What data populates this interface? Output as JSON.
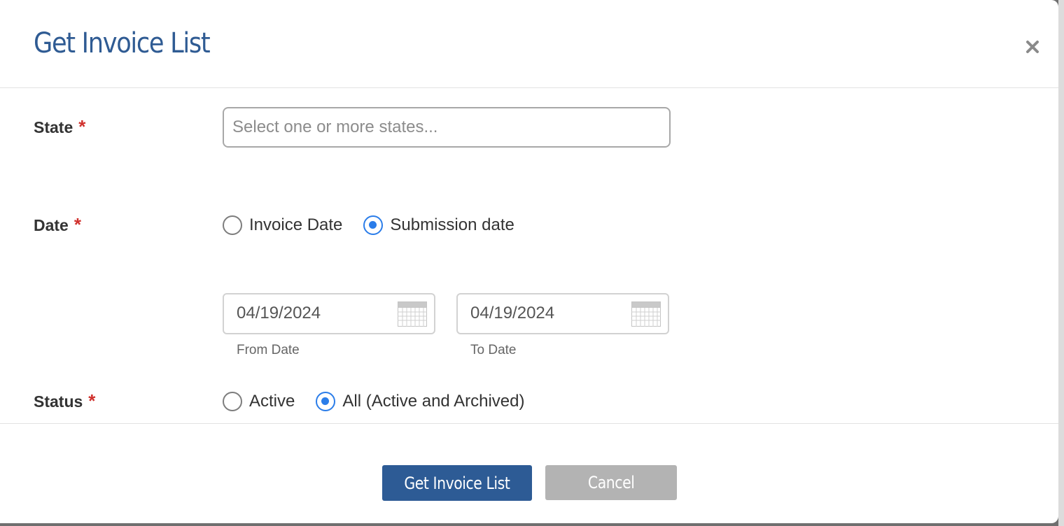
{
  "modal": {
    "title": "Get Invoice List",
    "close_icon": "close-icon"
  },
  "form": {
    "state": {
      "label": "State",
      "required_mark": "*",
      "placeholder": "Select one or more states...",
      "value": ""
    },
    "date": {
      "label": "Date",
      "required_mark": "*",
      "options": [
        {
          "label": "Invoice Date",
          "checked": false
        },
        {
          "label": "Submission date",
          "checked": true
        }
      ],
      "from": {
        "value": "04/19/2024",
        "caption": "From Date",
        "icon": "calendar-icon"
      },
      "to": {
        "value": "04/19/2024",
        "caption": "To Date",
        "icon": "calendar-icon"
      }
    },
    "status": {
      "label": "Status",
      "required_mark": "*",
      "options": [
        {
          "label": "Active",
          "checked": false
        },
        {
          "label": "All (Active and Archived)",
          "checked": true
        }
      ]
    }
  },
  "footer": {
    "submit_label": "Get Invoice List",
    "cancel_label": "Cancel"
  },
  "colors": {
    "title": "#2f5b93",
    "primary_button": "#2d5b95",
    "secondary_button": "#b3b3b3",
    "radio_checked": "#2b7de9",
    "required": "#d0312d"
  }
}
